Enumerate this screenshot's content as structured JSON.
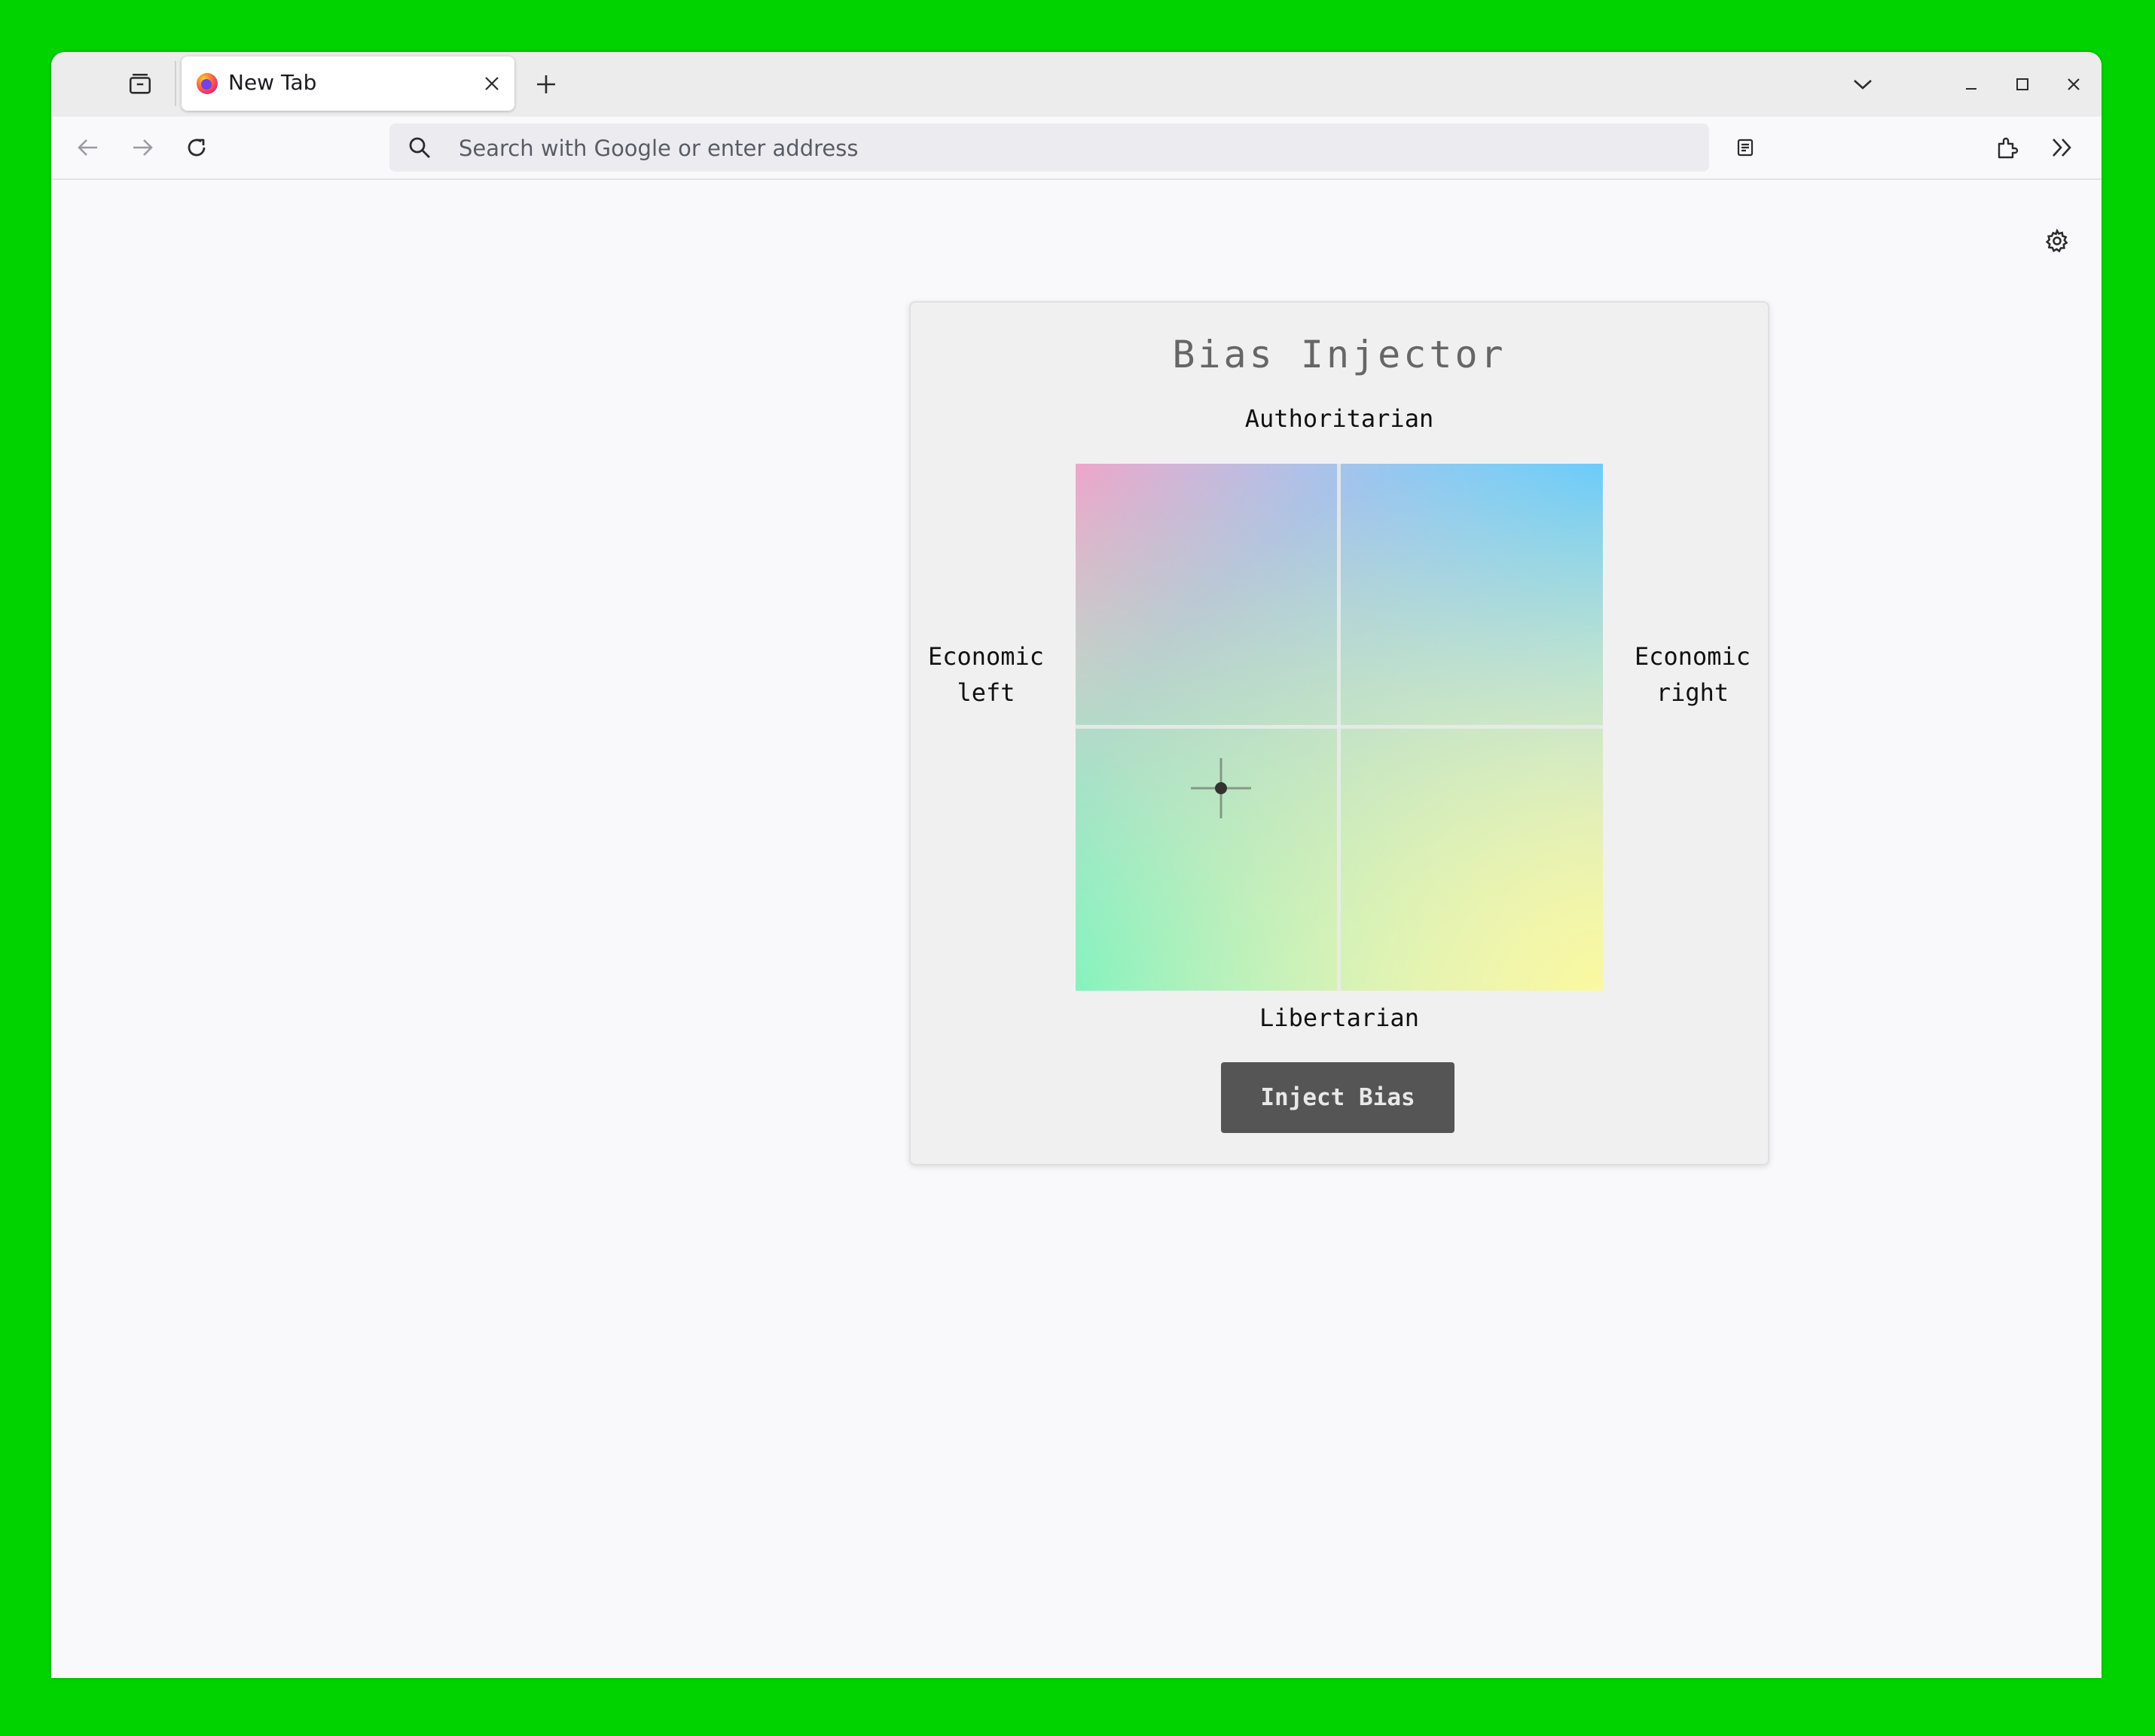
{
  "browser": {
    "tab": {
      "title": "New Tab"
    },
    "urlbar": {
      "placeholder": "Search with Google or enter address"
    }
  },
  "extension": {
    "title": "Bias Injector",
    "axes": {
      "top": "Authoritarian",
      "bottom": "Libertarian",
      "left_line1": "Economic",
      "left_line2": "left",
      "right_line1": "Economic",
      "right_line2": "right"
    },
    "selection": {
      "economic": -0.45,
      "social": -0.23
    },
    "quadrant_colors": {
      "authoritarian_left": "#ff9ec7",
      "authoritarian_right": "#63c8ff",
      "libertarian_left": "#7ef2c0",
      "libertarian_right": "#faf9a0"
    },
    "button": {
      "label": "Inject Bias"
    }
  },
  "icons": {
    "tab_overview": "tab-overview-icon",
    "firefox": "firefox-icon",
    "close_tab": "close-icon",
    "new_tab": "plus-icon",
    "tab_list": "chevron-down-icon",
    "minimize": "minimize-icon",
    "maximize": "maximize-icon",
    "close_window": "close-icon",
    "back": "back-arrow-icon",
    "forward": "forward-arrow-icon",
    "reload": "reload-icon",
    "search": "search-icon",
    "reader": "reader-view-icon",
    "extensions": "puzzle-icon",
    "overflow": "double-chevron-icon",
    "menu": "hamburger-menu-icon",
    "settings": "gear-icon"
  }
}
